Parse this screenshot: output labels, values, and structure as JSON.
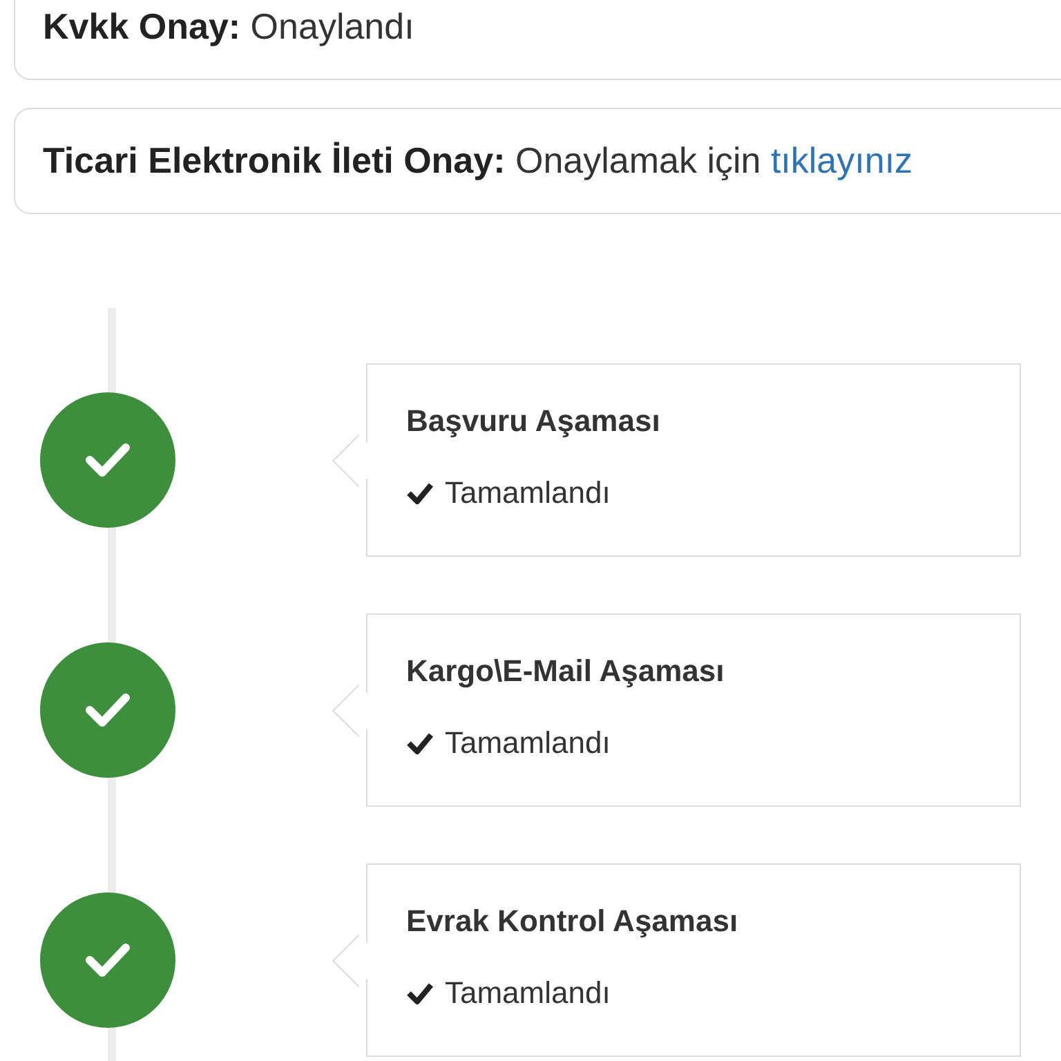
{
  "consents": [
    {
      "label": "Kvkk Onay:",
      "value": "Onaylandı"
    },
    {
      "label": "Ticari Elektronik İleti Onay:",
      "value": "Onaylamak için",
      "link": "tıklayınız"
    }
  ],
  "steps": [
    {
      "title": "Başvuru Aşaması",
      "status": "Tamamlandı",
      "completed": true
    },
    {
      "title": "Kargo\\E-Mail Aşaması",
      "status": "Tamamlandı",
      "completed": true
    },
    {
      "title": "Evrak Kontrol Aşaması",
      "status": "Tamamlandı",
      "completed": true
    }
  ]
}
